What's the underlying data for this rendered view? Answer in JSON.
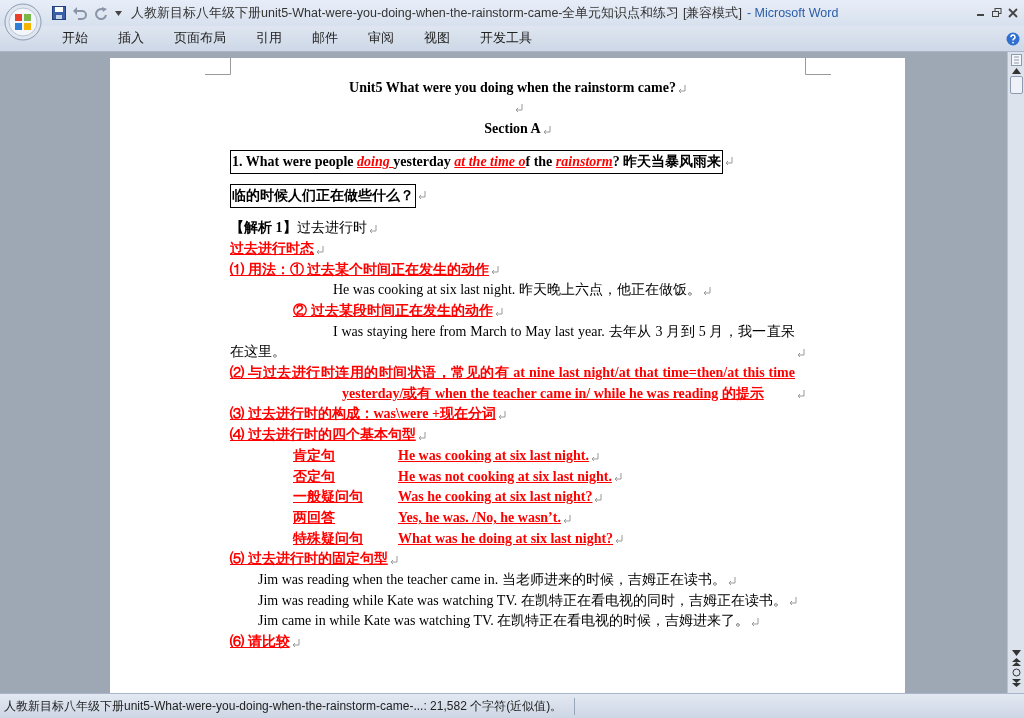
{
  "window": {
    "title": "人教新目标八年级下册unit5-What-were-you-doing-when-the-rainstorm-came-全单元知识点和练习 [兼容模式]",
    "app_name": "- Microsoft Word"
  },
  "ribbon_tabs": [
    {
      "label": "开始",
      "selected": false
    },
    {
      "label": "插入",
      "selected": false
    },
    {
      "label": "页面布局",
      "selected": false
    },
    {
      "label": "引用",
      "selected": false
    },
    {
      "label": "邮件",
      "selected": false
    },
    {
      "label": "审阅",
      "selected": false
    },
    {
      "label": "视图",
      "selected": false
    },
    {
      "label": "开发工具",
      "selected": false
    }
  ],
  "document": {
    "paragraphs": [
      {
        "kind": "title",
        "runs": [
          {
            "text": "Unit5 What were you doing when the rainstorm came?",
            "kind": "bold"
          }
        ]
      },
      {
        "kind": "title"
      },
      {
        "kind": "title",
        "runs": [
          {
            "text": "Section A",
            "kind": "bold"
          }
        ]
      },
      {
        "kind": "boxed",
        "runs": [
          {
            "text": "1. What were people ",
            "kind": "bold"
          },
          {
            "text": "doing ",
            "kind": "red_italic"
          },
          {
            "text": "yesterday ",
            "kind": "bold"
          },
          {
            "text": "at the time o",
            "kind": "red_italic"
          },
          {
            "text": "f the ",
            "kind": "bold"
          },
          {
            "text": "rainstorm",
            "kind": "red_italic"
          },
          {
            "text": "?  昨天当暴风雨来",
            "kind": "bold"
          }
        ]
      },
      {
        "kind": "boxed",
        "runs": [
          {
            "text": "临的时候人们正在做些什么？",
            "kind": "bold"
          }
        ]
      },
      {
        "kind": "body",
        "runs": [
          {
            "text": "【解析 1】",
            "kind": "bold"
          },
          {
            "text": "过去进行时",
            "kind": "plain"
          }
        ]
      },
      {
        "kind": "body",
        "runs": [
          {
            "text": "过去进行时态",
            "kind": "red"
          }
        ]
      },
      {
        "kind": "body",
        "runs": [
          {
            "text": "⑴ 用法：① 过去某个时间正在发生的动作",
            "kind": "red"
          }
        ]
      },
      {
        "kind": "example",
        "runs": [
          {
            "text": "He was cooking at six last night.  昨天晚上六点，他正在做饭。",
            "kind": "plain"
          }
        ]
      },
      {
        "kind": "sub",
        "runs": [
          {
            "text": " ② 过去某段时间正在发生的动作       ",
            "kind": "red"
          }
        ]
      },
      {
        "kind": "example",
        "runs": [
          {
            "text": "I was staying here from March to May last year.  去年从 3 月到 5 月，我一直呆在这里。",
            "kind": "plain"
          }
        ]
      },
      {
        "kind": "hanging",
        "runs": [
          {
            "text": "⑵ 与过去进行时连用的时间状语，常见的有  at nine last night/at that time=then/at this time yesterday/或有 when the teacher came in/   while he was reading 的提示",
            "kind": "red"
          }
        ]
      },
      {
        "kind": "body",
        "runs": [
          {
            "text": "⑶ 过去进行时的构成：was\\were +现在分词",
            "kind": "red"
          }
        ]
      },
      {
        "kind": "body",
        "runs": [
          {
            "text": "⑷ 过去进行时的四个基本句型",
            "kind": "red"
          }
        ]
      },
      {
        "kind": "pattern",
        "runs": [
          {
            "text": "肯定句",
            "kind": "red"
          },
          {
            "text": "He was cooking at six last night.",
            "kind": "red"
          }
        ]
      },
      {
        "kind": "pattern",
        "runs": [
          {
            "text": "否定句",
            "kind": "red"
          },
          {
            "text": "He was not cooking at six last night.",
            "kind": "red"
          }
        ]
      },
      {
        "kind": "pattern",
        "runs": [
          {
            "text": "一般疑问句",
            "kind": "red"
          },
          {
            "text": "Was he cooking at six last night?",
            "kind": "red"
          }
        ]
      },
      {
        "kind": "pattern",
        "runs": [
          {
            "text": "两回答",
            "kind": "red"
          },
          {
            "text": "Yes, he was. /No, he wasn’t.",
            "kind": "red"
          }
        ]
      },
      {
        "kind": "pattern",
        "runs": [
          {
            "text": "特殊疑问句",
            "kind": "red"
          },
          {
            "text": "What was he doing at six last night?",
            "kind": "red"
          }
        ]
      },
      {
        "kind": "body",
        "runs": [
          {
            "text": "⑸ 过去进行时的固定句型",
            "kind": "red"
          }
        ]
      },
      {
        "kind": "indent",
        "runs": [
          {
            "text": "Jim was reading when the teacher came in.  当老师进来的时候，吉姆正在读书。",
            "kind": "plain"
          }
        ]
      },
      {
        "kind": "indent",
        "runs": [
          {
            "text": "Jim was reading while Kate was watching TV.  在凯特正在看电视的同时，吉姆正在读书。",
            "kind": "plain"
          }
        ]
      },
      {
        "kind": "indent",
        "runs": [
          {
            "text": "Jim came in while Kate was watching TV.  在凯特正在看电视的时候，吉姆进来了。",
            "kind": "plain"
          }
        ]
      },
      {
        "kind": "body",
        "runs": [
          {
            "text": "⑹ 请比较",
            "kind": "red"
          }
        ]
      }
    ]
  },
  "status_bar": {
    "text": "人教新目标八年级下册unit5-What-were-you-doing-when-the-rainstorm-came-...: 21,582 个字符(近似值)。"
  }
}
